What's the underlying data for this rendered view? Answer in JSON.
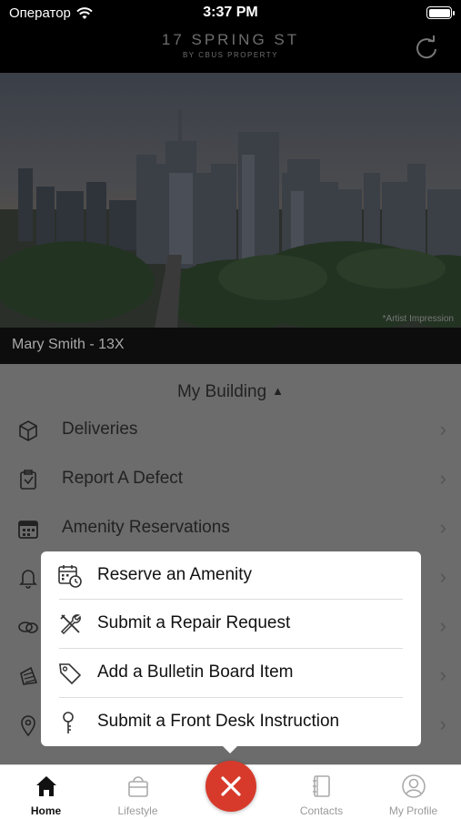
{
  "status_bar": {
    "carrier": "Оператор",
    "time": "3:37 PM",
    "battery_level": 1.0
  },
  "header": {
    "brand_name": "17 SPRING ST",
    "brand_sub": "BY CBUS PROPERTY",
    "refresh_icon": "refresh-icon"
  },
  "hero": {
    "caption": "*Artist Impression"
  },
  "resident": {
    "name": "Mary Smith - 13X"
  },
  "section": {
    "title": "My Building",
    "arrow": "▲"
  },
  "menu": {
    "items": [
      {
        "label": "Deliveries",
        "icon": "package-icon"
      },
      {
        "label": "Report A Defect",
        "icon": "defect-icon"
      },
      {
        "label": "Amenity Reservations",
        "icon": "calendar-icon"
      },
      {
        "label": "",
        "icon": "bell-icon"
      },
      {
        "label": "",
        "icon": "chat-icon"
      },
      {
        "label": "",
        "icon": "pinecone-icon"
      },
      {
        "label": "",
        "icon": "location-pin-icon"
      }
    ],
    "chevron": "›"
  },
  "popup": {
    "items": [
      {
        "label": "Reserve an Amenity",
        "icon": "calendar-clock-icon"
      },
      {
        "label": "Submit a Repair Request",
        "icon": "tools-icon"
      },
      {
        "label": "Add a Bulletin Board Item",
        "icon": "tag-icon"
      },
      {
        "label": "Submit a Front Desk Instruction",
        "icon": "key-icon"
      }
    ]
  },
  "tabbar": {
    "tabs": [
      {
        "label": "Home",
        "icon": "home-icon",
        "active": true
      },
      {
        "label": "Lifestyle",
        "icon": "shopping-bag-icon",
        "active": false
      },
      {
        "label": "Contacts",
        "icon": "contacts-book-icon",
        "active": false
      },
      {
        "label": "My Profile",
        "icon": "profile-icon",
        "active": false
      }
    ],
    "fab_icon": "close-icon"
  },
  "colors": {
    "accent": "#d73a2b",
    "menu_bg": "#6c6c6c",
    "dark": "#000000"
  }
}
